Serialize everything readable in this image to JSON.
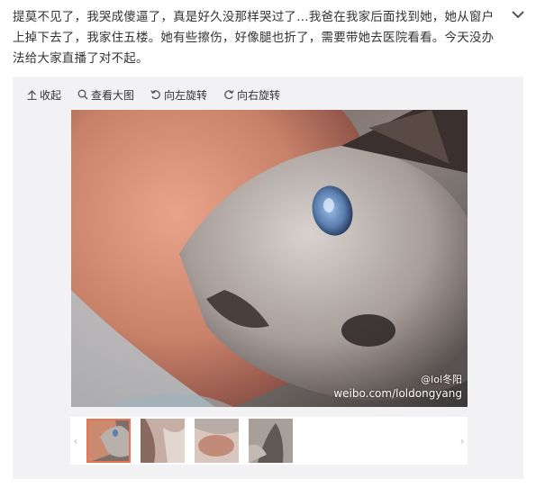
{
  "post": {
    "text_line1": "提莫不见了，我哭成傻逼了，真是好久没那样哭过了…我爸在我家后面找到她，她从窗户",
    "text_line2": "上掉下去了，我家住五楼。她有些擦伤，好像腿也折了，需要带她去医院看看。今天没办",
    "text_line3": "法给大家直播了对不起。"
  },
  "toolbar": {
    "collapse_label": "收起",
    "view_large_label": "查看大图",
    "rotate_left_label": "向左旋转",
    "rotate_right_label": "向右旋转"
  },
  "photo": {
    "watermark_handle": "@lol冬阳",
    "watermark_url": "weibo.com/loldongyang"
  },
  "thumbnails": {
    "count": 4,
    "active_index": 0
  },
  "colors": {
    "accent_orange": "#eb7350",
    "panel_bg": "#f2f2f5",
    "text": "#333333"
  }
}
